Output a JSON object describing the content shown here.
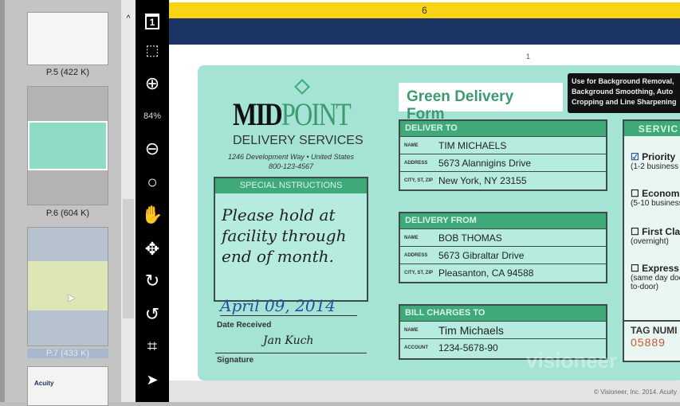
{
  "thumbnails": [
    {
      "label": "P.5 (422 K)",
      "selected": false
    },
    {
      "label": "P.6 (604 K)",
      "selected": false
    },
    {
      "label": "P.7 (433 K)",
      "selected": true
    }
  ],
  "toolbar": {
    "page_number": "1",
    "zoom": "84%",
    "tools": [
      "page-icon",
      "select-region-icon",
      "zoom-in-icon",
      "zoom-out-icon",
      "zoom-fit-icon",
      "hand-icon",
      "move-icon",
      "rotate-right-icon",
      "rotate-left-icon",
      "crop-icon",
      "pointer-icon"
    ]
  },
  "viewer": {
    "page_indicator": "6",
    "page_mark": "1"
  },
  "form": {
    "logo_mid": "MID",
    "logo_point": "POINT",
    "logo_sub": "DELIVERY SERVICES",
    "address": "1246 Development Way • United States",
    "phone": "800-123-4567",
    "title": "Green Delivery Form",
    "tooltip": [
      "Use for Background Removal,",
      "Background Smoothing, Auto",
      "Cropping and Line Sharpening"
    ],
    "special_header": "SPECIAL NSTRUCTIONS",
    "special_text": [
      "Please hold at",
      "facility through",
      "end of month."
    ],
    "date_value": "April 09, 2014",
    "date_label": "Date Received",
    "signature_label": "Signature",
    "deliver_to": {
      "header": "DELIVER TO",
      "rows": [
        {
          "k": "NAME",
          "v": "TIM MICHAELS"
        },
        {
          "k": "ADDRESS",
          "v": "5673 Alannigins Drive"
        },
        {
          "k": "CITY, ST, ZIP",
          "v": "New York, NY 23155"
        }
      ]
    },
    "delivery_from": {
      "header": "DELIVERY FROM",
      "rows": [
        {
          "k": "NAME",
          "v": "BOB THOMAS"
        },
        {
          "k": "ADDRESS",
          "v": "5673 Gibraltar Drive"
        },
        {
          "k": "CITY, ST, ZIP",
          "v": "Pleasanton, CA 94588"
        }
      ]
    },
    "bill_to": {
      "header": "BILL CHARGES TO",
      "rows": [
        {
          "k": "NAME",
          "v": "Tim Michaels"
        },
        {
          "k": "ACCOUNT",
          "v": "1234-5678-90"
        }
      ]
    },
    "service": {
      "header": "SERVIC",
      "options": [
        {
          "label": "Priority",
          "note": "(1-2 business",
          "checked": true
        },
        {
          "label": "Econom",
          "note": "(5-10 business",
          "checked": false
        },
        {
          "label": "First Cla",
          "note": "(overnight)",
          "checked": false
        },
        {
          "label": "Express",
          "note": "(same day door-to-door)",
          "checked": false
        }
      ]
    },
    "tag_label": "TAG NUMI",
    "tag_value": "05889",
    "watermark": "visioneer"
  },
  "footer": "© Visioneer, Inc. 2014. Acuity",
  "colors": {
    "toolbar": "#000000",
    "yellow_bar": "#f7d414",
    "navy_bar": "#1c3463",
    "form_bg": "#a5e4d5",
    "form_green": "#3fa97a"
  }
}
